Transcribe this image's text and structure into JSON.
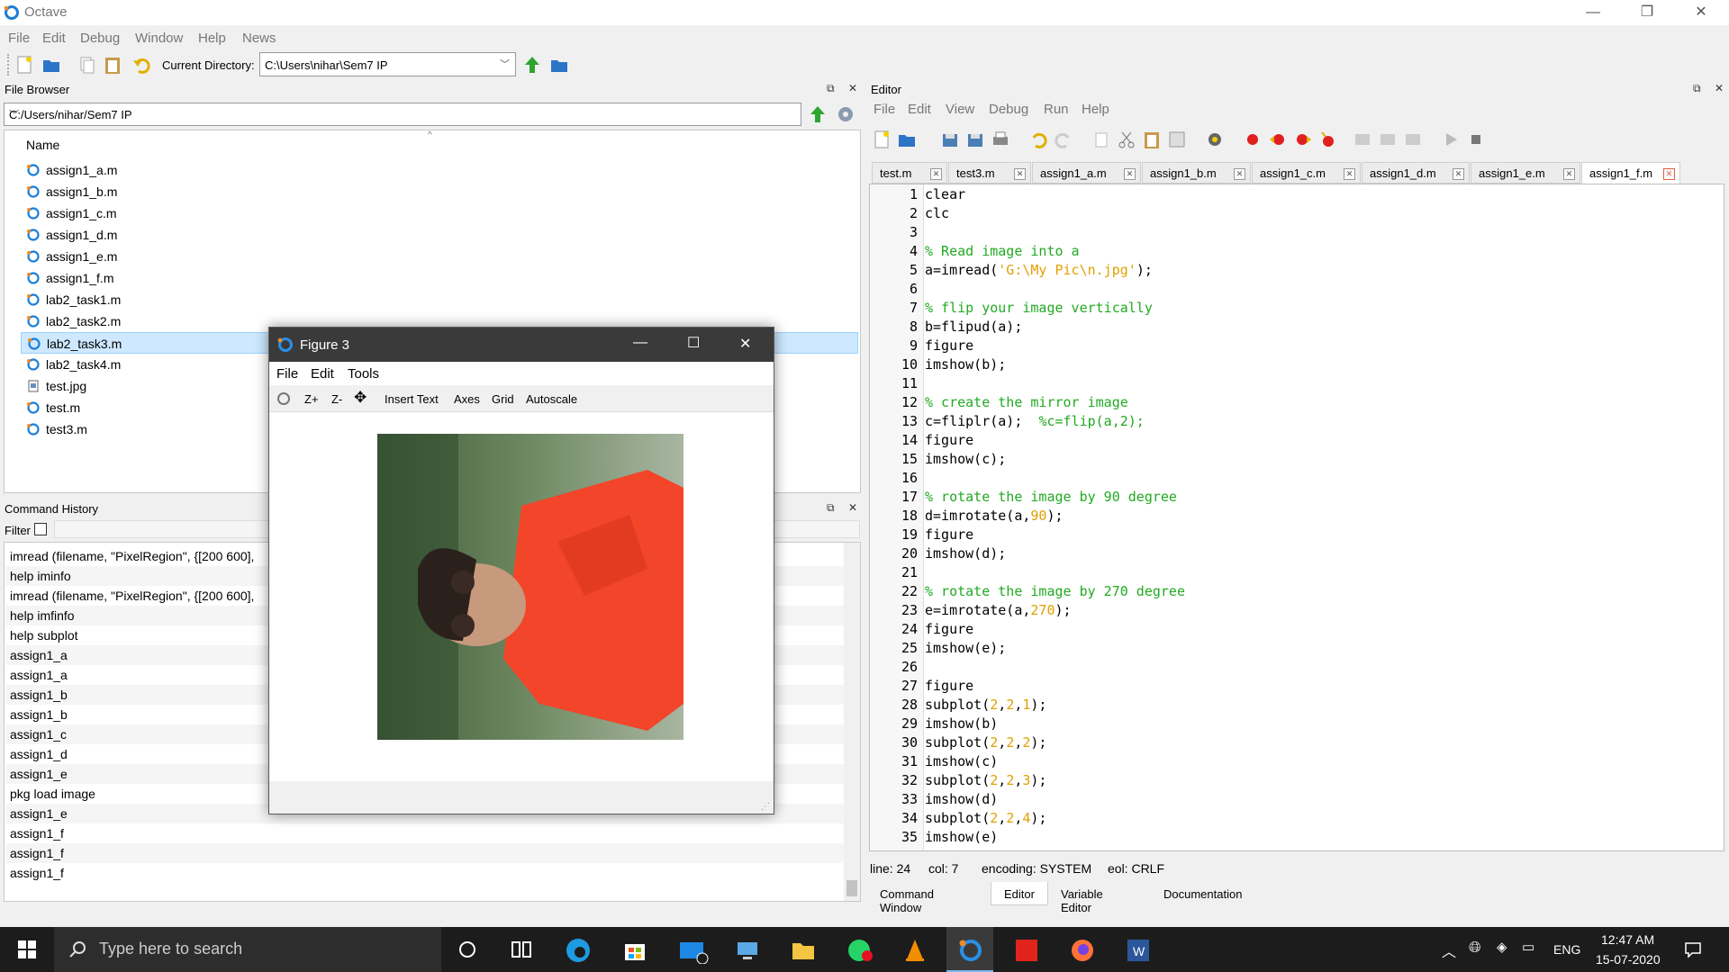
{
  "window": {
    "title": "Octave"
  },
  "menubar": [
    "File",
    "Edit",
    "Debug",
    "Window",
    "Help",
    "News"
  ],
  "toolbar": {
    "current_directory_label": "Current Directory:",
    "current_directory_value": "C:\\Users\\nihar\\Sem7 IP"
  },
  "file_browser": {
    "title": "File Browser",
    "path": "C:/Users/nihar/Sem7 IP",
    "column_name": "Name",
    "files": [
      {
        "name": "assign1_a.m",
        "type": "m"
      },
      {
        "name": "assign1_b.m",
        "type": "m"
      },
      {
        "name": "assign1_c.m",
        "type": "m"
      },
      {
        "name": "assign1_d.m",
        "type": "m"
      },
      {
        "name": "assign1_e.m",
        "type": "m"
      },
      {
        "name": "assign1_f.m",
        "type": "m"
      },
      {
        "name": "lab2_task1.m",
        "type": "m"
      },
      {
        "name": "lab2_task2.m",
        "type": "m"
      },
      {
        "name": "lab2_task3.m",
        "type": "m",
        "selected": true
      },
      {
        "name": "lab2_task4.m",
        "type": "m"
      },
      {
        "name": "test.jpg",
        "type": "jpg"
      },
      {
        "name": "test.m",
        "type": "m"
      },
      {
        "name": "test3.m",
        "type": "m"
      }
    ]
  },
  "command_history": {
    "title": "Command History",
    "filter_label": "Filter",
    "entries": [
      "imread (filename, \"PixelRegion\", {[200 600],",
      "help iminfo",
      "imread (filename, \"PixelRegion\", {[200 600],",
      "help imfinfo",
      "help subplot",
      "assign1_a",
      "assign1_a",
      "assign1_b",
      "assign1_b",
      "assign1_c",
      "assign1_d",
      "assign1_e",
      "pkg load image",
      "assign1_e",
      "assign1_f",
      "assign1_f",
      "assign1_f"
    ]
  },
  "editor": {
    "title": "Editor",
    "menu": [
      "File",
      "Edit",
      "View",
      "Debug",
      "Run",
      "Help"
    ],
    "tabs": [
      "test.m",
      "test3.m",
      "assign1_a.m",
      "assign1_b.m",
      "assign1_c.m",
      "assign1_d.m",
      "assign1_e.m",
      "assign1_f.m"
    ],
    "active_tab": "assign1_f.m",
    "lines": [
      [
        {
          "t": "clear"
        }
      ],
      [
        {
          "t": "clc"
        }
      ],
      [],
      [
        {
          "t": "% Read image into a",
          "c": "cm"
        }
      ],
      [
        {
          "t": "a=imread("
        },
        {
          "t": "'G:\\My Pic\\n.jpg'",
          "c": "st"
        },
        {
          "t": ");"
        }
      ],
      [],
      [
        {
          "t": "% flip your image vertically",
          "c": "cm"
        }
      ],
      [
        {
          "t": "b=flipud(a);"
        }
      ],
      [
        {
          "t": "figure"
        }
      ],
      [
        {
          "t": "imshow(b);"
        }
      ],
      [],
      [
        {
          "t": "% create the mirror image",
          "c": "cm"
        }
      ],
      [
        {
          "t": "c=fliplr(a);  "
        },
        {
          "t": "%c=flip(a,2);",
          "c": "cm"
        }
      ],
      [
        {
          "t": "figure"
        }
      ],
      [
        {
          "t": "imshow(c);"
        }
      ],
      [],
      [
        {
          "t": "% rotate the image by 90 degree",
          "c": "cm"
        }
      ],
      [
        {
          "t": "d=imrotate(a,"
        },
        {
          "t": "90",
          "c": "nu"
        },
        {
          "t": ");"
        }
      ],
      [
        {
          "t": "figure"
        }
      ],
      [
        {
          "t": "imshow(d);"
        }
      ],
      [],
      [
        {
          "t": "% rotate the image by 270 degree",
          "c": "cm"
        }
      ],
      [
        {
          "t": "e=imrotate(a,"
        },
        {
          "t": "270",
          "c": "nu"
        },
        {
          "t": ");"
        }
      ],
      [
        {
          "t": "figure"
        }
      ],
      [
        {
          "t": "imshow(e);"
        }
      ],
      [],
      [
        {
          "t": "figure"
        }
      ],
      [
        {
          "t": "subplot("
        },
        {
          "t": "2",
          "c": "nu"
        },
        {
          "t": ","
        },
        {
          "t": "2",
          "c": "nu"
        },
        {
          "t": ","
        },
        {
          "t": "1",
          "c": "nu"
        },
        {
          "t": ");"
        }
      ],
      [
        {
          "t": "imshow(b)"
        }
      ],
      [
        {
          "t": "subplot("
        },
        {
          "t": "2",
          "c": "nu"
        },
        {
          "t": ","
        },
        {
          "t": "2",
          "c": "nu"
        },
        {
          "t": ","
        },
        {
          "t": "2",
          "c": "nu"
        },
        {
          "t": ");"
        }
      ],
      [
        {
          "t": "imshow(c)"
        }
      ],
      [
        {
          "t": "subplot("
        },
        {
          "t": "2",
          "c": "nu"
        },
        {
          "t": ","
        },
        {
          "t": "2",
          "c": "nu"
        },
        {
          "t": ","
        },
        {
          "t": "3",
          "c": "nu"
        },
        {
          "t": ");"
        }
      ],
      [
        {
          "t": "imshow(d)"
        }
      ],
      [
        {
          "t": "subplot("
        },
        {
          "t": "2",
          "c": "nu"
        },
        {
          "t": ","
        },
        {
          "t": "2",
          "c": "nu"
        },
        {
          "t": ","
        },
        {
          "t": "4",
          "c": "nu"
        },
        {
          "t": ");"
        }
      ],
      [
        {
          "t": "imshow(e)"
        }
      ]
    ],
    "status": {
      "line": "line: 24",
      "col": "col: 7",
      "encoding": "encoding: SYSTEM",
      "eol": "eol: CRLF"
    }
  },
  "bottom_tabs": [
    "Command Window",
    "Editor",
    "Variable Editor",
    "Documentation"
  ],
  "bottom_active": "Editor",
  "figure": {
    "title": "Figure 3",
    "menu": [
      "File",
      "Edit",
      "Tools"
    ],
    "tools": [
      "Z+",
      "Z-",
      "Insert Text",
      "Axes",
      "Grid",
      "Autoscale"
    ]
  },
  "taskbar": {
    "search_placeholder": "Type here to search",
    "language": "ENG",
    "time": "12:47 AM",
    "date": "15-07-2020"
  },
  "colors": {
    "comment": "#22aa22",
    "string": "#e0a000",
    "selection": "#cde8ff",
    "taskbar": "#1c1c1c"
  }
}
